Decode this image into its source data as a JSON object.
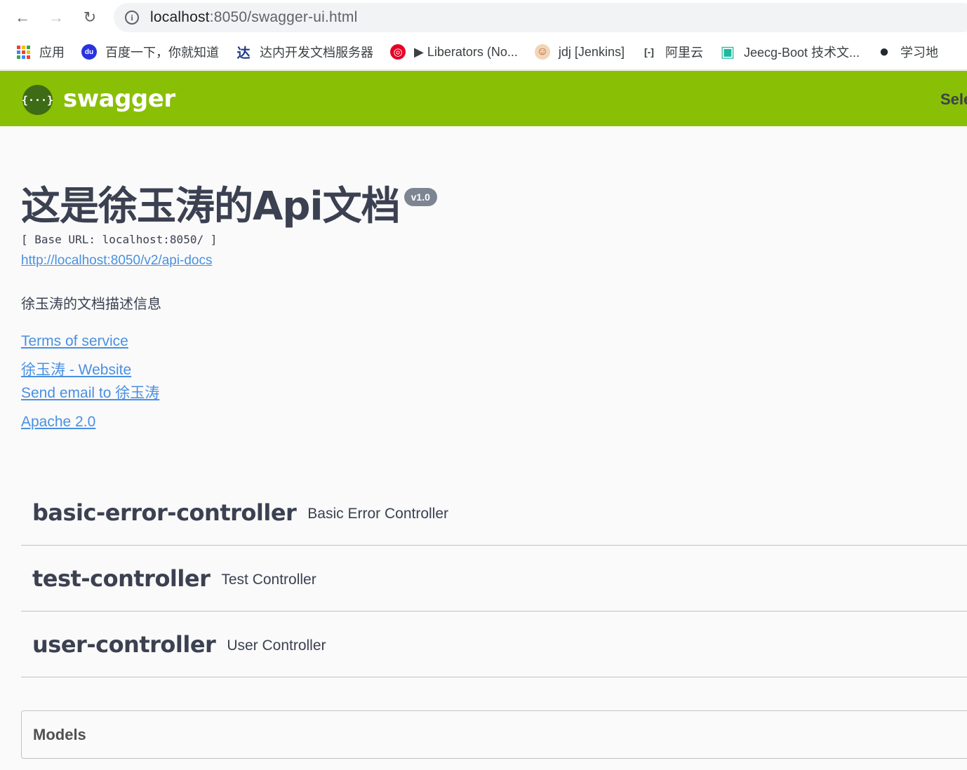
{
  "browser": {
    "back_label": "←",
    "forward_label": "→",
    "reload_label": "↻",
    "info_label": "i",
    "url_host": "localhost",
    "url_rest": ":8050/swagger-ui.html",
    "bookmarks": [
      {
        "label": "应用",
        "icon": "apps-grid-icon"
      },
      {
        "label": "百度一下，你就知道",
        "icon": "baidu-paw-icon",
        "glyph": "du",
        "color": "#2932e1"
      },
      {
        "label": "达内开发文档服务器",
        "icon": "tarena-icon",
        "glyph": "达",
        "color": "#1a3a8a"
      },
      {
        "label": "▶ Liberators (No...",
        "icon": "netease-music-icon",
        "glyph": "◎",
        "color": "#e60026"
      },
      {
        "label": "jdj [Jenkins]",
        "icon": "jenkins-icon",
        "glyph": "☺",
        "color": "#d24939"
      },
      {
        "label": "阿里云",
        "icon": "aliyun-icon",
        "glyph": "[-]",
        "color": "#3c4043"
      },
      {
        "label": "Jeecg-Boot 技术文...",
        "icon": "jeecg-icon",
        "glyph": "▣",
        "color": "#1fb89f"
      },
      {
        "label": "学习地",
        "icon": "github-icon",
        "glyph": "●",
        "color": "#24292e"
      }
    ]
  },
  "topbar": {
    "logo_glyph": "{···}",
    "logo_text": "swagger",
    "select_label": "Sele"
  },
  "info": {
    "title": "这是徐玉涛的Api文档",
    "version": "v1.0",
    "base_url": "[ Base URL: localhost:8050/ ]",
    "docs_url": "http://localhost:8050/v2/api-docs",
    "description": "徐玉涛的文档描述信息",
    "terms": "Terms of service",
    "website": "徐玉涛 - Website",
    "email": "Send email to 徐玉涛",
    "license": "Apache 2.0"
  },
  "tags": [
    {
      "name": "basic-error-controller",
      "description": "Basic Error Controller"
    },
    {
      "name": "test-controller",
      "description": "Test Controller"
    },
    {
      "name": "user-controller",
      "description": "User Controller"
    }
  ],
  "models": {
    "title": "Models"
  }
}
